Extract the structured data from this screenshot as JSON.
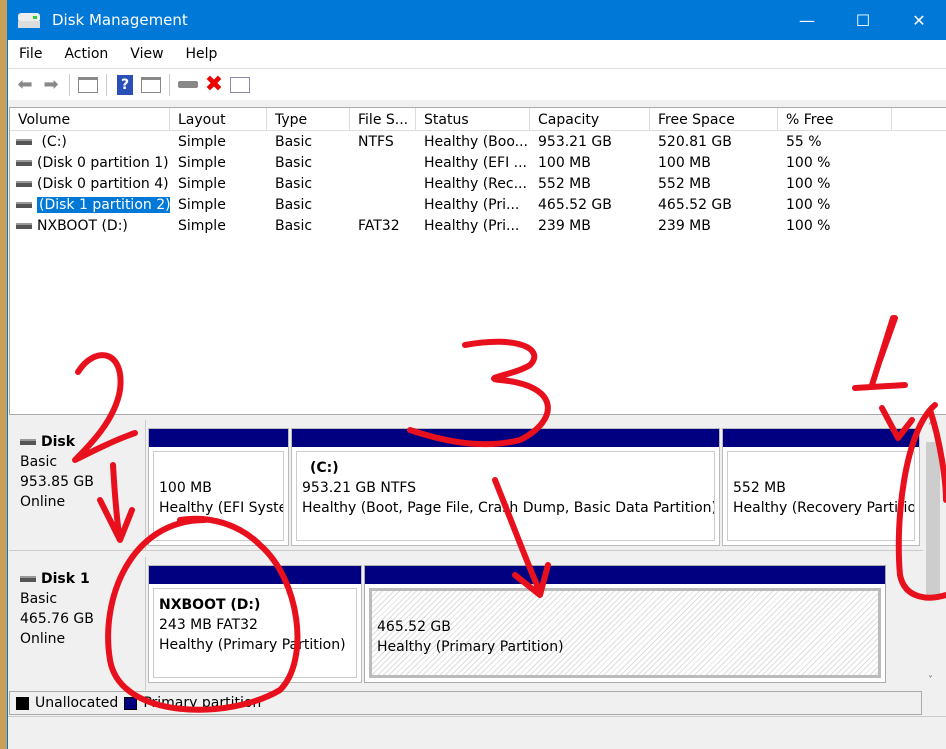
{
  "window": {
    "title": "Disk Management",
    "minimize": "—",
    "maximize": "☐",
    "close": "✕"
  },
  "menu": [
    "File",
    "Action",
    "View",
    "Help"
  ],
  "toolbar": [
    "back-icon",
    "forward-icon",
    "show-hide-console-tree-icon",
    "help-icon",
    "show-action-pane-icon",
    "connect-drive-icon",
    "delete-icon",
    "properties-icon"
  ],
  "volume_list": {
    "columns": [
      "Volume",
      "Layout",
      "Type",
      "File S...",
      "Status",
      "Capacity",
      "Free Space",
      "% Free"
    ],
    "rows": [
      {
        "volume": " (C:)",
        "layout": "Simple",
        "type": "Basic",
        "fs": "NTFS",
        "status": "Healthy (Boo...",
        "capacity": "953.21 GB",
        "free": "520.81 GB",
        "pct": "55 %"
      },
      {
        "volume": "(Disk 0 partition 1)",
        "layout": "Simple",
        "type": "Basic",
        "fs": "",
        "status": "Healthy (EFI ...",
        "capacity": "100 MB",
        "free": "100 MB",
        "pct": "100 %"
      },
      {
        "volume": "(Disk 0 partition 4)",
        "layout": "Simple",
        "type": "Basic",
        "fs": "",
        "status": "Healthy (Rec...",
        "capacity": "552 MB",
        "free": "552 MB",
        "pct": "100 %"
      },
      {
        "volume": "(Disk 1 partition 2)",
        "layout": "Simple",
        "type": "Basic",
        "fs": "",
        "status": "Healthy (Pri...",
        "capacity": "465.52 GB",
        "free": "465.52 GB",
        "pct": "100 %",
        "selected": true
      },
      {
        "volume": "NXBOOT (D:)",
        "layout": "Simple",
        "type": "Basic",
        "fs": "FAT32",
        "status": "Healthy (Pri...",
        "capacity": "239 MB",
        "free": "239 MB",
        "pct": "100 %"
      }
    ]
  },
  "disks": [
    {
      "name": "Disk",
      "type": "Basic",
      "size": "953.85 GB",
      "state": "Online",
      "partitions": [
        {
          "title": "",
          "size": "100 MB",
          "status": "Healthy (EFI System Partition)"
        },
        {
          "title": "(C:)",
          "size": "953.21 GB NTFS",
          "status": "Healthy (Boot, Page File, Crash Dump, Basic Data Partition)"
        },
        {
          "title": "",
          "size": "552 MB",
          "status": "Healthy (Recovery Partition)"
        }
      ]
    },
    {
      "name": "Disk 1",
      "type": "Basic",
      "size": "465.76 GB",
      "state": "Online",
      "partitions": [
        {
          "title": "NXBOOT  (D:)",
          "size": "243 MB FAT32",
          "status": "Healthy (Primary Partition)"
        },
        {
          "title": "",
          "size": "465.52 GB",
          "status": "Healthy (Primary Partition)"
        }
      ]
    }
  ],
  "legend": [
    {
      "label": "Unallocated",
      "color": "#000000"
    },
    {
      "label": "Primary partition",
      "color": "#000080"
    }
  ],
  "annotations": [
    "1",
    "2",
    "3"
  ],
  "colors": {
    "titlebar": "#0078d7",
    "partition_bar": "#000080",
    "annotation": "#e8101c"
  }
}
